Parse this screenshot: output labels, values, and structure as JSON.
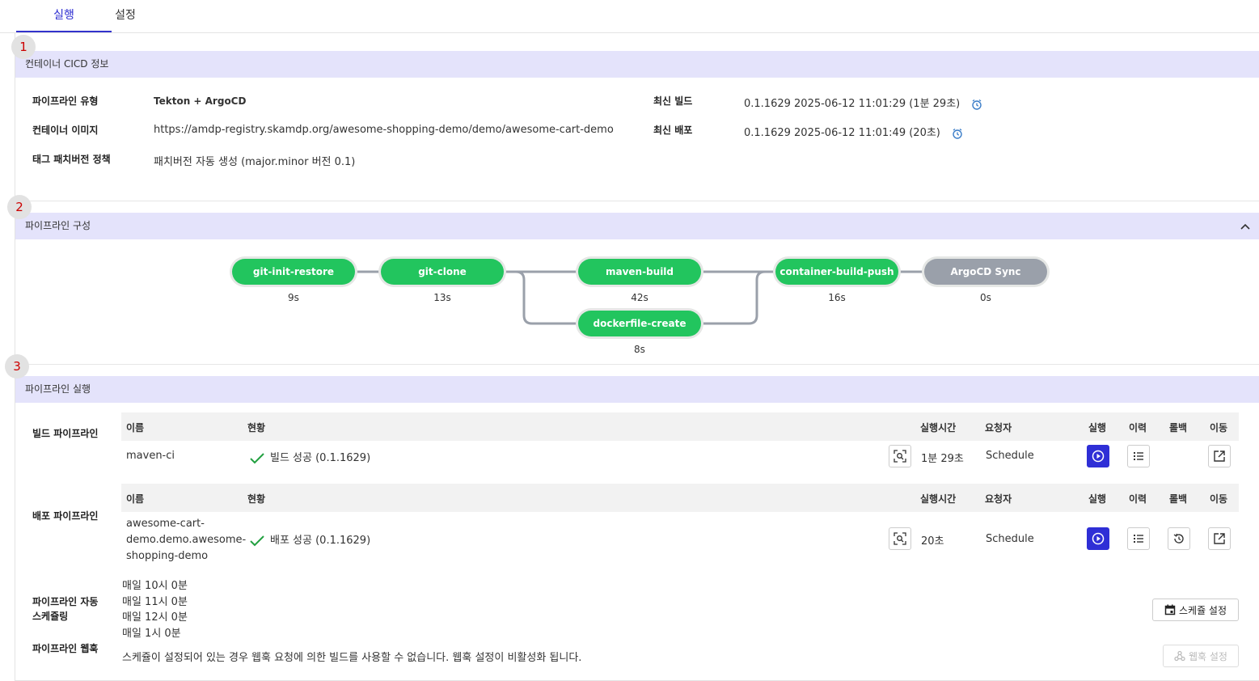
{
  "tabs": [
    {
      "label": "실행"
    },
    {
      "label": "설정"
    }
  ],
  "sections": [
    {
      "number": "1",
      "title": "컨테이너 CICD 정보"
    },
    {
      "number": "2",
      "title": "파이프라인 구성"
    },
    {
      "number": "3",
      "title": "파이프라인 실행"
    }
  ],
  "info": {
    "pipeline_type_label": "파이프라인 유형",
    "pipeline_type": "Tekton + ArgoCD",
    "image_label": "컨테이너 이미지",
    "image": "https://amdp-registry.skamdp.org/awesome-shopping-demo/demo/awesome-cart-demo",
    "tag_label": "태그 패치버전 정책",
    "tag": "패치버전 자동 생성 (major.minor 버전 0.1)",
    "latest_build_label": "최신 빌드",
    "latest_build": "0.1.1629 2025-06-12 11:01:29 (1분 29초)",
    "latest_deploy_label": "최신 배포",
    "latest_deploy": "0.1.1629 2025-06-12 11:01:49 (20초)"
  },
  "pipeline": {
    "stages": [
      {
        "name": "git-init-restore",
        "duration": "9s",
        "status": "success"
      },
      {
        "name": "git-clone",
        "duration": "13s",
        "status": "success"
      },
      {
        "name": "maven-build",
        "duration": "42s",
        "status": "success"
      },
      {
        "name": "dockerfile-create",
        "duration": "8s",
        "status": "success"
      },
      {
        "name": "container-build-push",
        "duration": "16s",
        "status": "success"
      },
      {
        "name": "ArgoCD Sync",
        "duration": "0s",
        "status": "pending"
      }
    ]
  },
  "run": {
    "headers": {
      "name": "이름",
      "status": "현황",
      "time": "실행시간",
      "requester": "요청자",
      "run": "실행",
      "history": "이력",
      "rollback": "롤백",
      "go": "이동"
    },
    "build": {
      "label": "빌드 파이프라인",
      "name": "maven-ci",
      "status": "빌드 성공 (0.1.1629)",
      "time": "1분 29초",
      "requester": "Schedule"
    },
    "deploy": {
      "label": "배포 파이프라인",
      "name_lines": [
        "awesome-cart-",
        "demo.demo.awesome-",
        "shopping-demo"
      ],
      "status": "배포 성공 (0.1.1629)",
      "time": "20초",
      "requester": "Schedule"
    },
    "schedule": {
      "label": "파이프라인 자동 스케쥴링",
      "items": [
        "매일 10시 0분",
        "매일 11시 0분",
        "매일 12시 0분",
        "매일 1시 0분"
      ],
      "button": "스케쥴 설정"
    },
    "webhook": {
      "label": "파이프라인 웹훅",
      "text": "스케쥴이 설정되어 있는 경우 웹훅 요청에 의한 빌드를 사용할 수 없습니다. 웹훅 설정이 비활성화 됩니다.",
      "button": "웹훅 설정"
    }
  },
  "colors": {
    "accent": "#2f2fd6",
    "success": "#22c55e",
    "pending": "#9aa0aa",
    "section_bg": "#e4e3fb"
  }
}
